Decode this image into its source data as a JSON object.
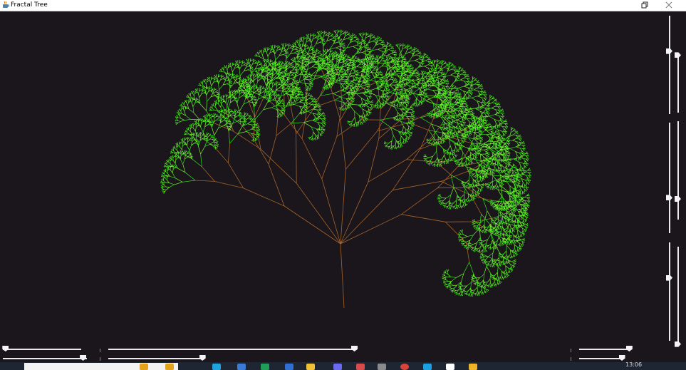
{
  "window": {
    "title": "Fractal Tree",
    "icon": "java-cup-icon",
    "controls": [
      "restore-icon",
      "close-icon"
    ]
  },
  "colors": {
    "background": "#1b161c",
    "branch": "#a6642a",
    "leaf_light": "#7af52c",
    "leaf_dark": "#2fe11a",
    "slider_track": "#e9e9ef"
  },
  "sliders": [
    {
      "id": "slider-bottom-left-top",
      "value": 0.03
    },
    {
      "id": "slider-bottom-left-bottom",
      "value": 0.95
    },
    {
      "id": "slider-bottom-center-top",
      "value": 1.0
    },
    {
      "id": "slider-bottom-center-bottom",
      "value": 0.99
    },
    {
      "id": "slider-bottom-right-top",
      "value": 0.97
    },
    {
      "id": "slider-bottom-right-bottom",
      "value": 0.96
    },
    {
      "id": "slider-right-1",
      "value": 0.36
    },
    {
      "id": "slider-right-2",
      "value": 0.04
    },
    {
      "id": "slider-right-3",
      "value": 0.68
    },
    {
      "id": "slider-right-4",
      "value": 0.79
    },
    {
      "id": "slider-right-5",
      "value": 0.36
    },
    {
      "id": "slider-right-6",
      "value": 0.99
    }
  ],
  "taskbar": {
    "clock": "13:06",
    "icons": [
      "palm-icon",
      "palm-icon",
      "browser-icon",
      "store-icon",
      "spreadsheet-icon",
      "mail-icon",
      "folder-icon",
      "paint-icon",
      "media-icon",
      "app-icon",
      "chrome-icon",
      "edit-icon",
      "java-icon",
      "notes-icon"
    ]
  }
}
